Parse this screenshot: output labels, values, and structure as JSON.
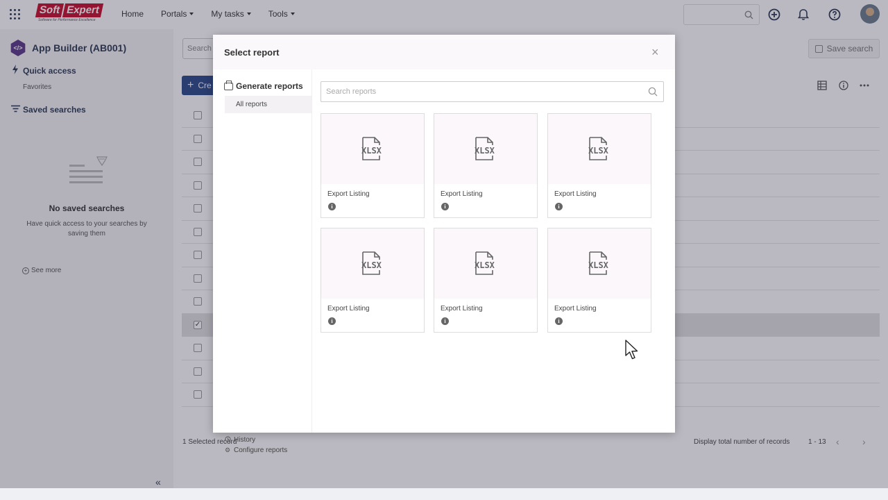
{
  "topbar": {
    "logo_soft": "Soft",
    "logo_expert": "Expert",
    "logo_tagline": "Software for Performance Excellence",
    "nav": [
      {
        "label": "Home",
        "dropdown": false
      },
      {
        "label": "Portals",
        "dropdown": true
      },
      {
        "label": "My tasks",
        "dropdown": true
      },
      {
        "label": "Tools",
        "dropdown": true
      }
    ],
    "icons": [
      "apps-grid-icon",
      "search-icon",
      "plus-circle-icon",
      "bell-icon",
      "help-icon",
      "avatar"
    ]
  },
  "sidebar": {
    "app_icon_text": "</>",
    "app_title": "App Builder (AB001)",
    "quick_access": "Quick access",
    "favorites": "Favorites",
    "saved_searches": "Saved searches",
    "empty_title": "No saved searches",
    "empty_text": "Have quick access to your searches by saving them",
    "see_more": "See more",
    "collapse": "«"
  },
  "main": {
    "search_placeholder": "Search",
    "save_search": "Save search",
    "create_label": "Cre",
    "rows": [
      false,
      false,
      false,
      false,
      false,
      false,
      false,
      false,
      false,
      true,
      false,
      false,
      false
    ],
    "selected_count": "1 Selected record",
    "display_total": "Display total number of records",
    "range": "1 - 13"
  },
  "modal": {
    "title": "Select report",
    "close": "×",
    "generate_reports": "Generate reports",
    "all_reports": "All reports",
    "search_placeholder": "Search reports",
    "history": "History",
    "configure_reports": "Configure reports",
    "cards": [
      {
        "label": "Export Listing",
        "format": "XLSX"
      },
      {
        "label": "Export Listing",
        "format": "XLSX"
      },
      {
        "label": "Export Listing",
        "format": "XLSX"
      },
      {
        "label": "Export Listing",
        "format": "XLSX"
      },
      {
        "label": "Export Listing",
        "format": "XLSX"
      },
      {
        "label": "Export Listing",
        "format": "XLSX"
      }
    ]
  },
  "colors": {
    "brand_red": "#c8102e",
    "navy": "#2b3b55",
    "app_purple": "#5b3a8a",
    "create_blue": "#2b4a8a",
    "overlay": "rgba(40,35,60,0.32)"
  }
}
